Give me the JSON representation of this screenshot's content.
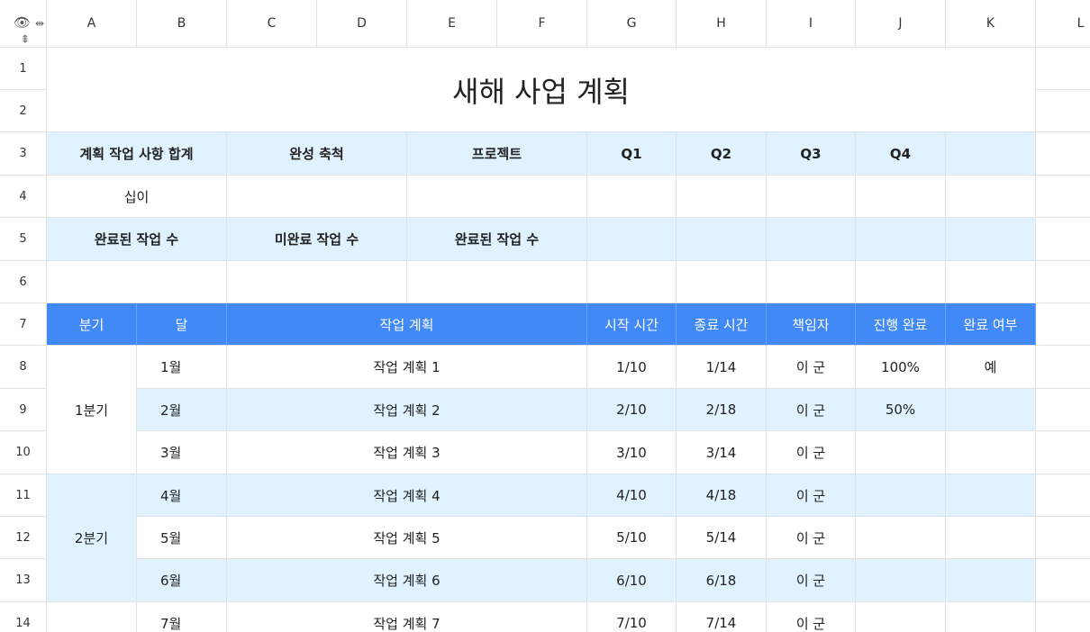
{
  "column_headers": [
    "A",
    "B",
    "C",
    "D",
    "E",
    "F",
    "G",
    "H",
    "I",
    "J",
    "K",
    "L"
  ],
  "row_numbers": [
    "1",
    "2",
    "3",
    "4",
    "5",
    "6",
    "7",
    "8",
    "9",
    "10",
    "11",
    "12",
    "13",
    "14"
  ],
  "title": "새해 사업 계획",
  "summary": {
    "total_label": "계획 작업 사항 합계",
    "completion_label": "완성 축척",
    "project_label": "프로젝트",
    "quarters": [
      "Q1",
      "Q2",
      "Q3",
      "Q4"
    ],
    "total_value": "십이",
    "completed_label": "완료된 작업 수",
    "incomplete_label": "미완료 작업 수",
    "completed_label2": "완료된 작업 수"
  },
  "table": {
    "headers": {
      "quarter": "분기",
      "month": "달",
      "plan": "작업 계획",
      "start": "시작 시간",
      "end": "종료 시간",
      "owner": "책임자",
      "progress": "진행 완료",
      "done": "완료 여부"
    },
    "quarter_labels": [
      "1분기",
      "2분기"
    ],
    "rows": [
      {
        "month": "1월",
        "plan": "작업 계획 1",
        "start": "1/10",
        "end": "1/14",
        "owner": "이 군",
        "progress": "100%",
        "done": "예"
      },
      {
        "month": "2월",
        "plan": "작업 계획 2",
        "start": "2/10",
        "end": "2/18",
        "owner": "이 군",
        "progress": "50%",
        "done": ""
      },
      {
        "month": "3월",
        "plan": "작업 계획 3",
        "start": "3/10",
        "end": "3/14",
        "owner": "이 군",
        "progress": "",
        "done": ""
      },
      {
        "month": "4월",
        "plan": "작업 계획 4",
        "start": "4/10",
        "end": "4/18",
        "owner": "이 군",
        "progress": "",
        "done": ""
      },
      {
        "month": "5월",
        "plan": "작업 계획 5",
        "start": "5/10",
        "end": "5/14",
        "owner": "이 군",
        "progress": "",
        "done": ""
      },
      {
        "month": "6월",
        "plan": "작업 계획 6",
        "start": "6/10",
        "end": "6/18",
        "owner": "이 군",
        "progress": "",
        "done": ""
      },
      {
        "month": "7월",
        "plan": "작업 계획 7",
        "start": "7/10",
        "end": "7/14",
        "owner": "이 군",
        "progress": "",
        "done": ""
      }
    ]
  },
  "icons": {
    "eye": "eye-icon",
    "freeze_columns": "freeze-columns-icon",
    "freeze_rows": "freeze-rows-icon"
  },
  "colors": {
    "header_blue": "#4189f6",
    "light_blue": "#dff2fd",
    "grid_line": "#e2e2e2"
  }
}
